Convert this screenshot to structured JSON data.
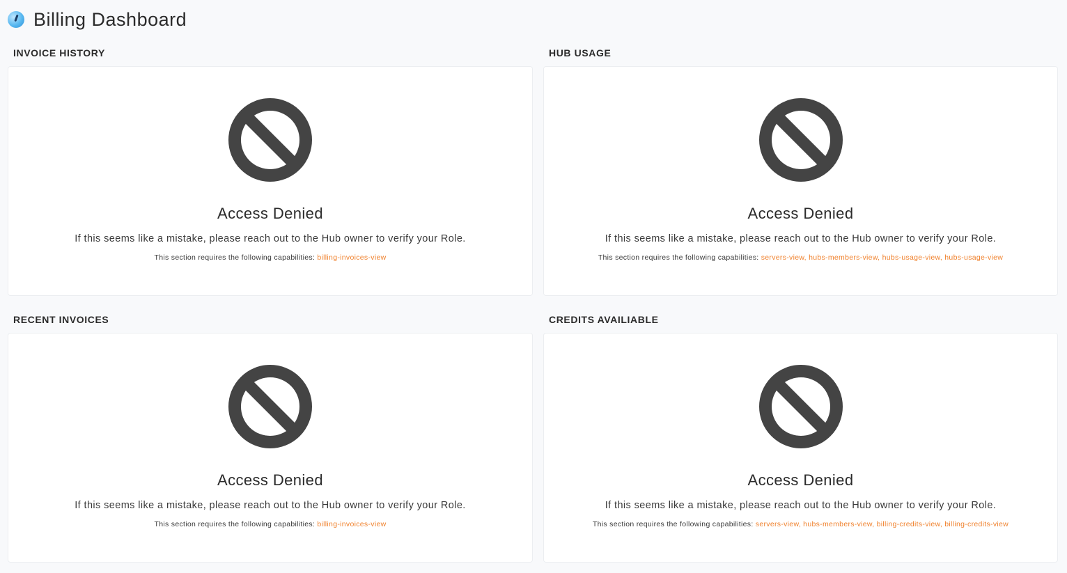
{
  "header": {
    "title": "Billing Dashboard",
    "logo_icon": "gauge-logo-icon"
  },
  "colors": {
    "background": "#f8f9fb",
    "card": "#ffffff",
    "icon": "#444444",
    "capability_link": "#f0822e"
  },
  "sections": [
    {
      "label": "INVOICE HISTORY",
      "icon": "no-entry-icon",
      "title": "Access Denied",
      "message": "If this seems like a mistake, please reach out to the Hub owner to verify your Role.",
      "caps_prefix": "This section requires the following capabilities:",
      "capabilities": "billing-invoices-view"
    },
    {
      "label": "HUB USAGE",
      "icon": "no-entry-icon",
      "title": "Access Denied",
      "message": "If this seems like a mistake, please reach out to the Hub owner to verify your Role.",
      "caps_prefix": "This section requires the following capabilities:",
      "capabilities": "servers-view, hubs-members-view, hubs-usage-view, hubs-usage-view"
    },
    {
      "label": "RECENT INVOICES",
      "icon": "no-entry-icon",
      "title": "Access Denied",
      "message": "If this seems like a mistake, please reach out to the Hub owner to verify your Role.",
      "caps_prefix": "This section requires the following capabilities:",
      "capabilities": "billing-invoices-view"
    },
    {
      "label": "CREDITS AVAILIABLE",
      "icon": "no-entry-icon",
      "title": "Access Denied",
      "message": "If this seems like a mistake, please reach out to the Hub owner to verify your Role.",
      "caps_prefix": "This section requires the following capabilities:",
      "capabilities": "servers-view, hubs-members-view, billing-credits-view, billing-credits-view"
    }
  ]
}
